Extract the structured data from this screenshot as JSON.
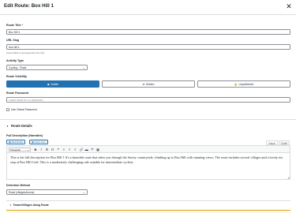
{
  "modal": {
    "title": "Edit Route: Box Hill 1",
    "close_icon": "close-icon"
  },
  "fields": {
    "route_title": {
      "label": "Route Title *",
      "value": "Box Hill 1"
    },
    "url_slug": {
      "label": "URL Slug",
      "value": "box-hill-1",
      "hint": "Leave blank to auto-generate from title"
    },
    "activity_type": {
      "label": "Activity Type",
      "value": "Cycling - Road"
    },
    "route_visibility": {
      "label": "Route Visibility",
      "options": [
        {
          "label": "Visible",
          "icon": "eye-icon",
          "selected": true
        },
        {
          "label": "Hidden",
          "icon": "eye-slash-icon",
          "selected": false
        },
        {
          "label": "Unpublished",
          "icon": "lock-icon",
          "selected": false
        }
      ]
    },
    "route_password": {
      "label": "Route Password",
      "placeholder": "Leave blank for no password"
    },
    "global_password": {
      "label": "Use Global Password",
      "checked": false
    }
  },
  "route_details": {
    "title": "Route Details",
    "description": {
      "label": "Full Description (Narrative)",
      "add_media": "Add Media",
      "insert_icon": "Insert Icon",
      "tabs": [
        "Visual",
        "Code"
      ],
      "active_tab": "Visual",
      "format_select": "Paragraph",
      "toolbar_icons": [
        "bold-icon",
        "italic-icon",
        "bullet-list-icon",
        "numbered-list-icon",
        "blockquote-icon",
        "align-left-icon",
        "align-center-icon",
        "align-right-icon",
        "link-icon",
        "read-more-icon",
        "fullscreen-icon",
        "toolbar-toggle-icon"
      ],
      "text": "This is the full description for Box Hill 1 It's a beautiful route that takes you through the Surrey countryside, climbing up to Box Hill with stunning views. The route includes several villages and a lovely tea stop at Box Hill Café. This is a moderately challenging ride suitable for intermediate cyclists."
    },
    "detection_method": {
      "label": "Detection Method",
      "value": "Road (villages/towns)"
    },
    "towns_section": {
      "title": "Towns/Villages Along Route"
    }
  },
  "colors": {
    "primary": "#2271b1",
    "text": "#1d2327",
    "border": "#8c8f94",
    "highlight": "#fcf9e8"
  }
}
